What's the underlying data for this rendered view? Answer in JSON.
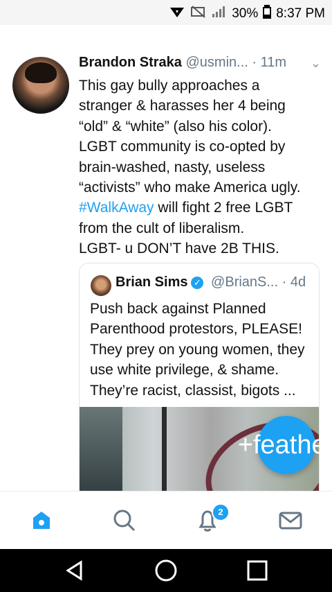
{
  "status_bar": {
    "battery": "30%",
    "time": "8:37 PM",
    "icons": [
      "signal-icon",
      "no-data-icon",
      "battery-icon"
    ]
  },
  "tweet": {
    "author_name": "Brandon Straka",
    "author_handle": "@usmin...",
    "separator": "·",
    "time": "11m",
    "chevron": "⌄",
    "text_lines": [
      "This gay bully approaches a",
      "stranger  & harasses her 4 being",
      "“old” & “white” (also his color).",
      "LGBT community is co-opted by",
      "brain-washed, nasty, useless",
      "“activists” who make America ugly.",
      "#WalkAway",
      " will fight 2 free LGBT",
      "from the cult of liberalism.",
      "LGBT- u DON’T have 2B THIS."
    ]
  },
  "quoted_tweet": {
    "author_name": "Brian Sims",
    "verified": "✓",
    "author_handle": "@BrianS...",
    "separator": "·",
    "time": "4d",
    "text_lines": [
      "Push back against Planned",
      "Parenthood protestors, PLEASE!",
      "They prey on young women, they",
      "use white privilege, & shame.",
      "They’re racist, classist, bigots ..."
    ]
  },
  "compose_button": {
    "icon": "+feather"
  },
  "bottom_tabs": {
    "items": [
      "home",
      "search",
      "notifications",
      "messages"
    ],
    "badge": "2"
  },
  "colors": {
    "twitter_blue": "#1da1f2",
    "text": "#111111",
    "muted": "#657786"
  }
}
